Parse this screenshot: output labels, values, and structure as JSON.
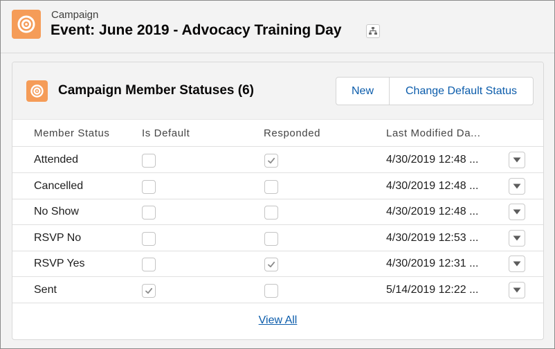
{
  "page_header": {
    "object_label": "Campaign",
    "title": "Event: June 2019 - Advocacy Training Day"
  },
  "card": {
    "title": "Campaign Member Statuses (6)",
    "buttons": {
      "new": "New",
      "change_default": "Change Default Status"
    },
    "columns": [
      "Member Status",
      "Is Default",
      "Responded",
      "Last Modified Da..."
    ],
    "rows": [
      {
        "status": "Attended",
        "is_default": false,
        "responded": true,
        "modified": "4/30/2019 12:48 ..."
      },
      {
        "status": "Cancelled",
        "is_default": false,
        "responded": false,
        "modified": "4/30/2019 12:48 ..."
      },
      {
        "status": "No Show",
        "is_default": false,
        "responded": false,
        "modified": "4/30/2019 12:48 ..."
      },
      {
        "status": "RSVP No",
        "is_default": false,
        "responded": false,
        "modified": "4/30/2019 12:53 ..."
      },
      {
        "status": "RSVP Yes",
        "is_default": false,
        "responded": true,
        "modified": "4/30/2019 12:31 ..."
      },
      {
        "status": "Sent",
        "is_default": true,
        "responded": false,
        "modified": "5/14/2019 12:22 ..."
      }
    ],
    "view_all": "View All"
  },
  "icons": {
    "campaign": "campaign-target-icon",
    "hierarchy": "hierarchy-icon",
    "checked": "checkmark-icon",
    "row_menu": "chevron-down-icon"
  },
  "colors": {
    "campaign_icon": "#f59c58",
    "link": "#0b5cab"
  }
}
